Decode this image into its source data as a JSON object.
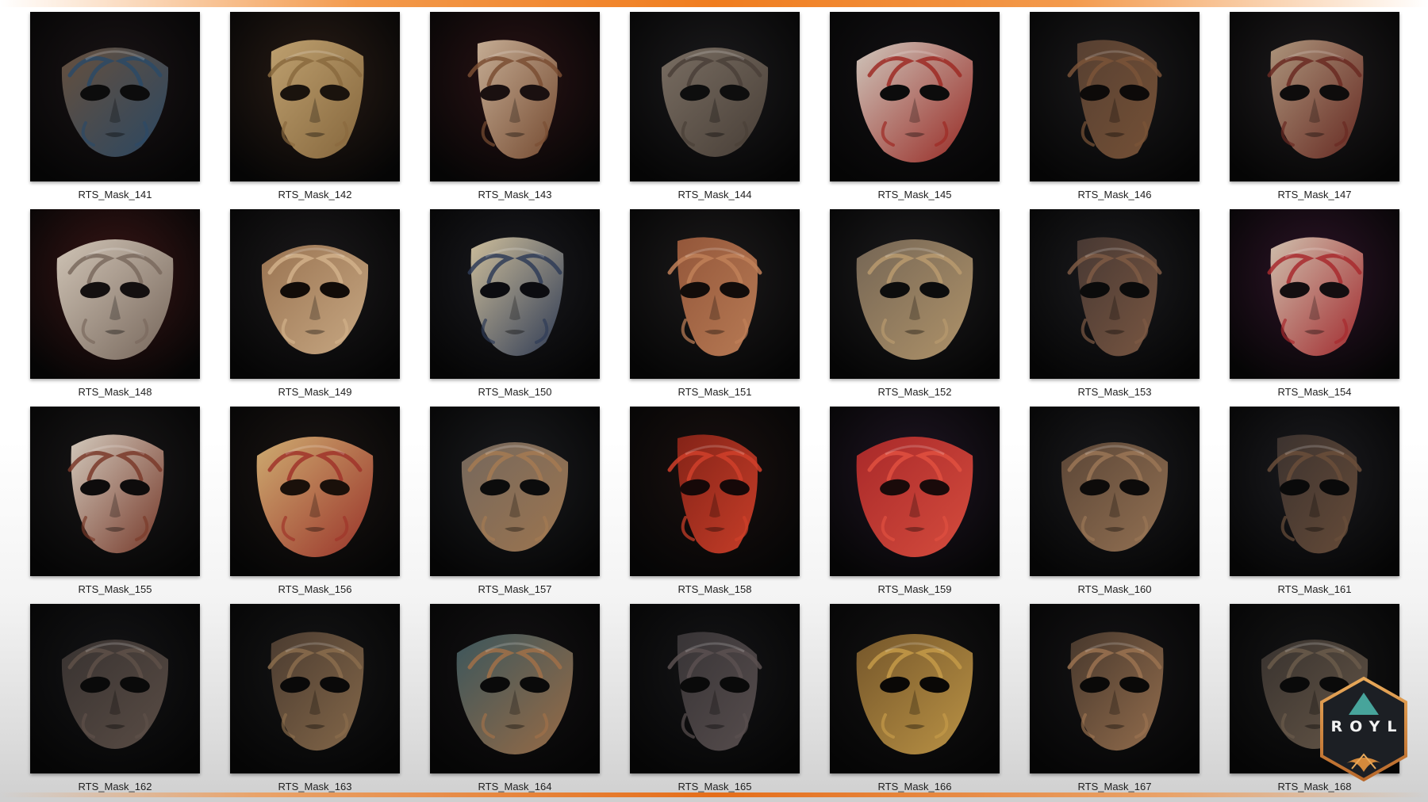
{
  "gallery": {
    "items": [
      {
        "label": "RTS_Mask_141",
        "bg": "#1a1416",
        "face": "#6a5340",
        "accent": "#2c4a66",
        "eyes": "#0c0c0c",
        "variant": 0
      },
      {
        "label": "RTS_Mask_142",
        "bg": "#2a1d16",
        "face": "#c6a774",
        "accent": "#8a6a3e",
        "eyes": "#1a130d",
        "variant": 1
      },
      {
        "label": "RTS_Mask_143",
        "bg": "#2a1315",
        "face": "#cdb49a",
        "accent": "#7a4e33",
        "eyes": "#1a1010",
        "variant": 2
      },
      {
        "label": "RTS_Mask_144",
        "bg": "#1c1b1d",
        "face": "#7e7266",
        "accent": "#4a4038",
        "eyes": "#0e0e0e",
        "variant": 0
      },
      {
        "label": "RTS_Mask_145",
        "bg": "#141215",
        "face": "#d9cfc4",
        "accent": "#9e2a24",
        "eyes": "#0c0c0c",
        "variant": 3
      },
      {
        "label": "RTS_Mask_146",
        "bg": "#1b1a1c",
        "face": "#5a4233",
        "accent": "#7a5438",
        "eyes": "#0d0a09",
        "variant": 2
      },
      {
        "label": "RTS_Mask_147",
        "bg": "#1f1c1e",
        "face": "#b39a80",
        "accent": "#6a2a22",
        "eyes": "#0e0c0c",
        "variant": 1
      },
      {
        "label": "RTS_Mask_148",
        "bg": "#3a1616",
        "face": "#d8cdbe",
        "accent": "#7a6a5e",
        "eyes": "#141010",
        "variant": 3
      },
      {
        "label": "RTS_Mask_149",
        "bg": "#1c1a1c",
        "face": "#a07854",
        "accent": "#d1b089",
        "eyes": "#120c08",
        "variant": 0
      },
      {
        "label": "RTS_Mask_150",
        "bg": "#1b1b20",
        "face": "#d6c6a2",
        "accent": "#2f3c57",
        "eyes": "#0c0c10",
        "variant": 1
      },
      {
        "label": "RTS_Mask_151",
        "bg": "#1d1b1c",
        "face": "#9a5a3c",
        "accent": "#c08058",
        "eyes": "#120c0a",
        "variant": 2
      },
      {
        "label": "RTS_Mask_152",
        "bg": "#1e1d1f",
        "face": "#7a6a58",
        "accent": "#b89a6e",
        "eyes": "#0d0d0d",
        "variant": 3
      },
      {
        "label": "RTS_Mask_153",
        "bg": "#1c1c1f",
        "face": "#4a3a34",
        "accent": "#7e5a44",
        "eyes": "#0b0b0b",
        "variant": 2
      },
      {
        "label": "RTS_Mask_154",
        "bg": "#2e1428",
        "face": "#d8c8b4",
        "accent": "#a82a2e",
        "eyes": "#140e10",
        "variant": 1
      },
      {
        "label": "RTS_Mask_155",
        "bg": "#1a1819",
        "face": "#dcd2c4",
        "accent": "#7a3a2a",
        "eyes": "#0e0c0c",
        "variant": 1
      },
      {
        "label": "RTS_Mask_156",
        "bg": "#1c1614",
        "face": "#d8b476",
        "accent": "#a0342a",
        "eyes": "#1a100a",
        "variant": 3
      },
      {
        "label": "RTS_Mask_157",
        "bg": "#1b1c1f",
        "face": "#7a6c60",
        "accent": "#a47a52",
        "eyes": "#0c0c0c",
        "variant": 0
      },
      {
        "label": "RTS_Mask_158",
        "bg": "#1a1110",
        "face": "#8a2418",
        "accent": "#d0402a",
        "eyes": "#160808",
        "variant": 2
      },
      {
        "label": "RTS_Mask_159",
        "bg": "#201624",
        "face": "#b02a2a",
        "accent": "#e05040",
        "eyes": "#1a0a0a",
        "variant": 3
      },
      {
        "label": "RTS_Mask_160",
        "bg": "#1b1b1e",
        "face": "#5e4838",
        "accent": "#9a7656",
        "eyes": "#0d0b0a",
        "variant": 0
      },
      {
        "label": "RTS_Mask_161",
        "bg": "#1c1c20",
        "face": "#3e3430",
        "accent": "#6a4e3a",
        "eyes": "#0a0a0a",
        "variant": 2
      },
      {
        "label": "RTS_Mask_162",
        "bg": "#141416",
        "face": "#3a3432",
        "accent": "#5e5048",
        "eyes": "#0a0a0a",
        "variant": 0
      },
      {
        "label": "RTS_Mask_163",
        "bg": "#151516",
        "face": "#4e3e32",
        "accent": "#8a6c4c",
        "eyes": "#0a0909",
        "variant": 1
      },
      {
        "label": "RTS_Mask_164",
        "bg": "#141214",
        "face": "#3e5a60",
        "accent": "#a07048",
        "eyes": "#0a0a0a",
        "variant": 3
      },
      {
        "label": "RTS_Mask_165",
        "bg": "#151517",
        "face": "#3a3638",
        "accent": "#5a5050",
        "eyes": "#0a0a0a",
        "variant": 2
      },
      {
        "label": "RTS_Mask_166",
        "bg": "#141314",
        "face": "#7a5a2c",
        "accent": "#c49a48",
        "eyes": "#0a0806",
        "variant": 3
      },
      {
        "label": "RTS_Mask_167",
        "bg": "#151416",
        "face": "#4a3a2e",
        "accent": "#9a7250",
        "eyes": "#0a0908",
        "variant": 1
      },
      {
        "label": "RTS_Mask_168",
        "bg": "#151516",
        "face": "#3a3430",
        "accent": "#6a5a4a",
        "eyes": "#0a0a0a",
        "variant": 0
      }
    ]
  },
  "watermark": {
    "text": "ROYL",
    "colors": {
      "gold": "#d58a3c",
      "dark": "#1c1f24",
      "mountain": "#4cb3a8"
    }
  },
  "accent_colors": {
    "orange": "#f07d1f"
  }
}
